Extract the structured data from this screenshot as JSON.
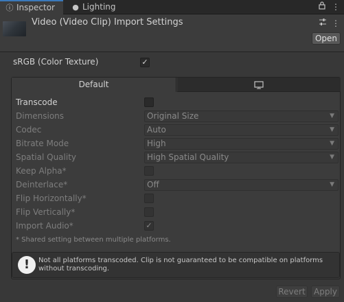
{
  "tabs": [
    {
      "label": "Inspector",
      "icon": "info-icon",
      "active": true
    },
    {
      "label": "Lighting",
      "icon": "lightbulb-icon",
      "active": false
    }
  ],
  "header": {
    "title": "Video (Video Clip) Import Settings",
    "open_label": "Open"
  },
  "srgb": {
    "label": "sRGB (Color Texture)",
    "checked": true
  },
  "platform_tabs": {
    "default_label": "Default",
    "other_icon": "monitor-icon"
  },
  "settings": {
    "transcode": {
      "label": "Transcode",
      "checked": false
    },
    "dimensions": {
      "label": "Dimensions",
      "value": "Original Size"
    },
    "codec": {
      "label": "Codec",
      "value": "Auto"
    },
    "bitrate_mode": {
      "label": "Bitrate Mode",
      "value": "High"
    },
    "spatial_quality": {
      "label": "Spatial Quality",
      "value": "High Spatial Quality"
    },
    "keep_alpha": {
      "label": "Keep Alpha*",
      "checked": false
    },
    "deinterlace": {
      "label": "Deinterlace*",
      "value": "Off"
    },
    "flip_horizontally": {
      "label": "Flip Horizontally*",
      "checked": false
    },
    "flip_vertically": {
      "label": "Flip Vertically*",
      "checked": false
    },
    "import_audio": {
      "label": "Import Audio*",
      "checked": true
    }
  },
  "shared_note": "* Shared setting between multiple platforms.",
  "warning": {
    "text": "Not all platforms transcoded. Clip is not guaranteed to be compatible on platforms without transcoding."
  },
  "footer": {
    "revert_label": "Revert",
    "apply_label": "Apply"
  }
}
